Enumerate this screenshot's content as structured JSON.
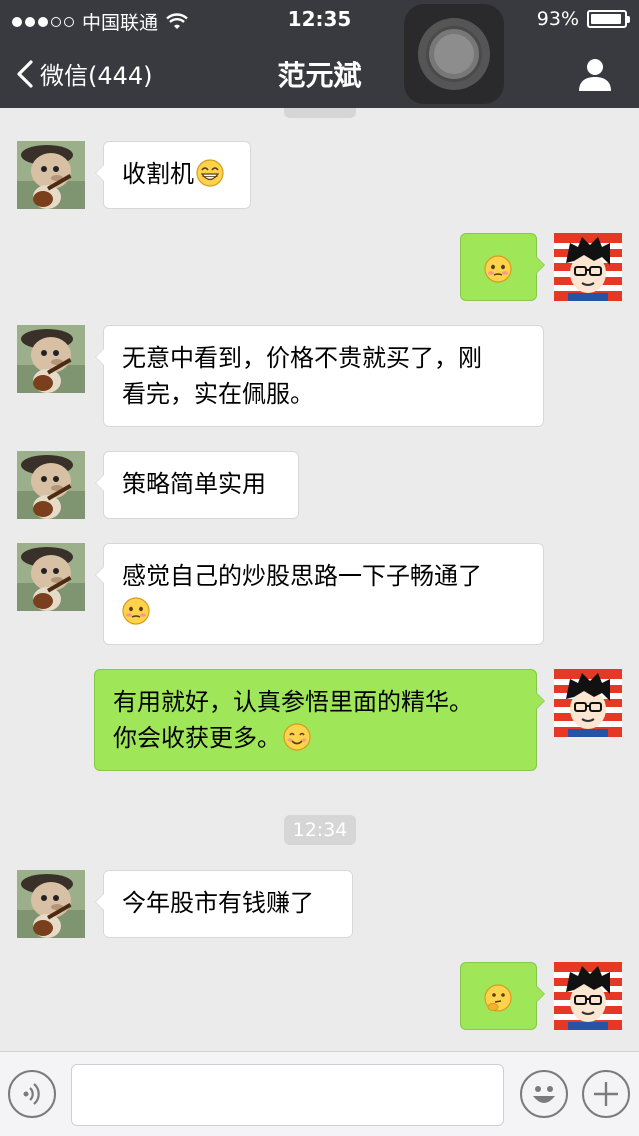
{
  "status_bar": {
    "carrier": "中国联通",
    "time": "12:35",
    "battery": "93%",
    "battery_level": 0.93,
    "signal_dots_filled": 3,
    "signal_dots_total": 5
  },
  "nav": {
    "back_label": "微信(444)",
    "title": "范元斌"
  },
  "chat": {
    "timestamp": "12:34",
    "messages": [
      {
        "side": "in",
        "text": "收割机",
        "emoji": "grin-emoji"
      },
      {
        "side": "out",
        "text": "",
        "emoji": "blush-emoji"
      },
      {
        "side": "in",
        "line1": "无意中看到，价格不贵就买了，刚",
        "line2": "看完，实在佩服。"
      },
      {
        "side": "in",
        "text": "策略简单实用"
      },
      {
        "side": "in",
        "line1": "感觉自己的炒股思路一下子畅通了",
        "emoji": "blush-emoji"
      },
      {
        "side": "out",
        "line1": "有用就好，认真参悟里面的精华。",
        "line2": "你会收获更多。",
        "emoji": "smile-emoji"
      },
      {
        "side": "in",
        "text": "今年股市有钱赚了"
      },
      {
        "side": "out",
        "text": "",
        "emoji": "thinking-emoji"
      }
    ]
  },
  "colors": {
    "nav_bg": "#393a3f",
    "chat_bg": "#ebebeb",
    "out_bubble": "#9fe658",
    "in_bubble": "#ffffff"
  },
  "input_bar": {
    "voice_icon": "voice-icon",
    "emoji_icon": "emoji-face-icon",
    "plus_icon": "plus-icon"
  }
}
